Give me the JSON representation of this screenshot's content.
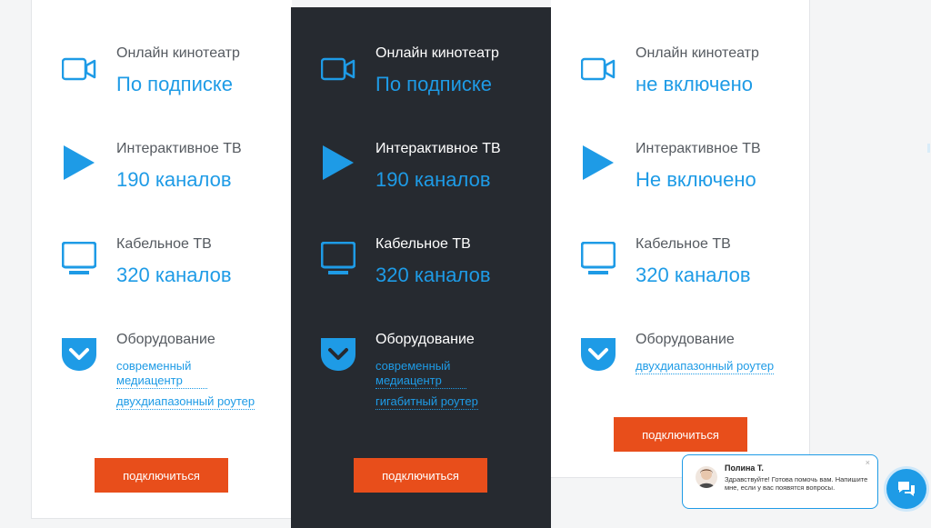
{
  "colors": {
    "accent": "#1e9be6",
    "button": "#e84e1b",
    "dark_card": "#262a30"
  },
  "plans": [
    {
      "cinema": {
        "label": "Онлайн кинотеатр",
        "value": "По подписке"
      },
      "iptv": {
        "label": "Интерактивное ТВ",
        "value": "190 каналов"
      },
      "cable": {
        "label": "Кабельное ТВ",
        "value": "320 каналов"
      },
      "equipment": {
        "label": "Оборудование",
        "items": [
          "современный медиацентр",
          "двухдиапазонный роутер"
        ]
      },
      "button": "подключиться"
    },
    {
      "cinema": {
        "label": "Онлайн кинотеатр",
        "value": "По подписке"
      },
      "iptv": {
        "label": "Интерактивное ТВ",
        "value": "190 каналов"
      },
      "cable": {
        "label": "Кабельное ТВ",
        "value": "320 каналов"
      },
      "equipment": {
        "label": "Оборудование",
        "items": [
          "современный медиацентр",
          "гигабитный роутер"
        ]
      },
      "button": "подключиться"
    },
    {
      "cinema": {
        "label": "Онлайн кинотеатр",
        "value": "не включено"
      },
      "iptv": {
        "label": "Интерактивное ТВ",
        "value": "Не включено"
      },
      "cable": {
        "label": "Кабельное ТВ",
        "value": "320 каналов"
      },
      "equipment": {
        "label": "Оборудование",
        "items": [
          "двухдиапазонный роутер"
        ]
      },
      "button": "подключиться"
    }
  ],
  "icons": {
    "cinema": "video-camera-icon",
    "iptv": "play-icon",
    "cable": "monitor-icon",
    "equipment": "pocket-chevron-icon"
  },
  "chat": {
    "name": "Полина Т.",
    "message": "Здравствуйте! Готова помочь вам. Напишите мне, если у вас появятся вопросы.",
    "close": "×"
  }
}
